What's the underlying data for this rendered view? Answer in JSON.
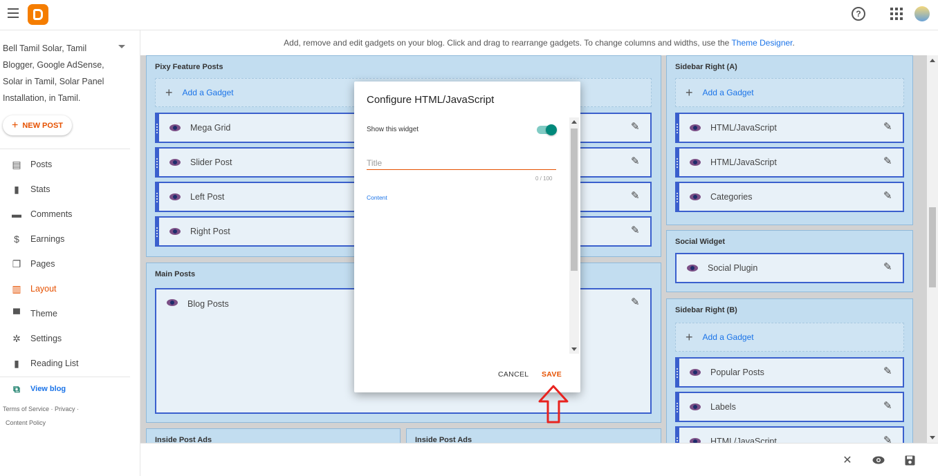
{
  "topbar": {
    "help_glyph": "?"
  },
  "sidebar": {
    "blog_name": "Bell Tamil Solar, Tamil Blogger, Google AdSense, Solar in Tamil, Solar Panel Installation, in Tamil.",
    "new_post_label": "NEW POST",
    "items": [
      {
        "label": "Posts",
        "icon": "posts-icon"
      },
      {
        "label": "Stats",
        "icon": "stats-icon"
      },
      {
        "label": "Comments",
        "icon": "comments-icon"
      },
      {
        "label": "Earnings",
        "icon": "earnings-icon"
      },
      {
        "label": "Pages",
        "icon": "pages-icon"
      },
      {
        "label": "Layout",
        "icon": "layout-icon",
        "active": true
      },
      {
        "label": "Theme",
        "icon": "theme-icon"
      },
      {
        "label": "Settings",
        "icon": "settings-icon"
      },
      {
        "label": "Reading List",
        "icon": "reading-list-icon"
      }
    ],
    "view_blog": "View blog",
    "footer": {
      "terms": "Terms of Service",
      "privacy": "Privacy",
      "content_policy": "Content Policy"
    }
  },
  "main": {
    "hint_text": "Add, remove and edit gadgets on your blog. Click and drag to rearrange gadgets. To change columns and widths, use the ",
    "hint_link": "Theme Designer",
    "hint_end": ".",
    "sections": {
      "pixy": {
        "title": "Pixy Feature Posts",
        "add_gadget": "Add a Gadget",
        "gadgets": [
          "Mega Grid",
          "Slider Post",
          "Left Post",
          "Right Post"
        ]
      },
      "main_posts": {
        "title": "Main Posts",
        "gadgets": [
          "Blog Posts"
        ]
      },
      "sidebar_a": {
        "title": "Sidebar Right (A)",
        "add_gadget": "Add a Gadget",
        "gadgets": [
          "HTML/JavaScript",
          "HTML/JavaScript",
          "Categories"
        ]
      },
      "social": {
        "title": "Social Widget",
        "gadgets": [
          "Social Plugin"
        ]
      },
      "sidebar_b": {
        "title": "Sidebar Right (B)",
        "add_gadget": "Add a Gadget",
        "gadgets": [
          "Popular Posts",
          "Labels",
          "HTML/JavaScript"
        ]
      },
      "inside_ads_left": {
        "title": "Inside Post Ads"
      },
      "inside_ads_right": {
        "title": "Inside Post Ads"
      }
    }
  },
  "dialog": {
    "title": "Configure HTML/JavaScript",
    "show_widget_label": "Show this widget",
    "show_widget_on": true,
    "title_placeholder": "Title",
    "title_value": "",
    "counter": "0 / 100",
    "content_label": "Content",
    "cancel_label": "CANCEL",
    "save_label": "SAVE"
  },
  "colors": {
    "accent_orange": "#e65100",
    "link_blue": "#1a73e8",
    "toggle_teal": "#00897b",
    "gadget_border": "#3a5fcd",
    "annotation_red": "#e8231f"
  }
}
